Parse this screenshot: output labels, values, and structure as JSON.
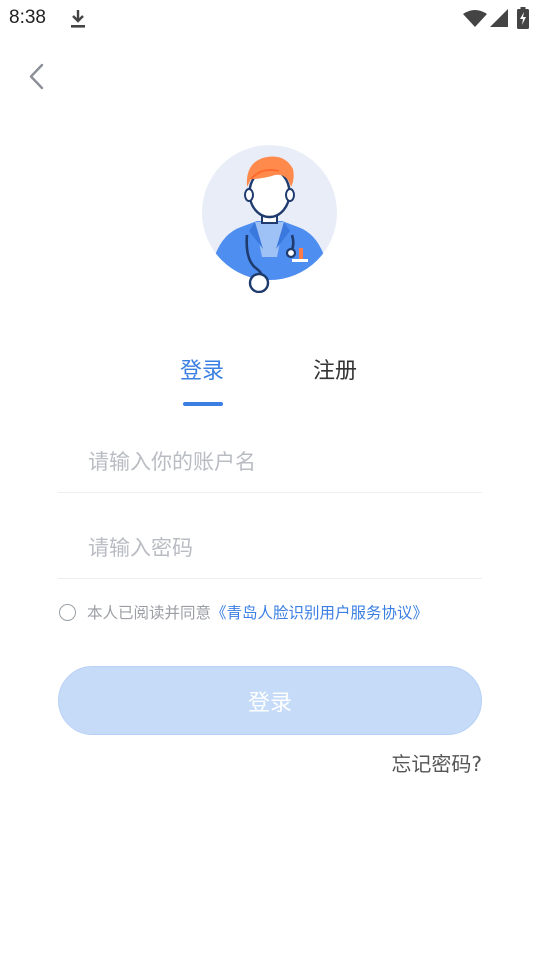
{
  "status_bar": {
    "time": "8:38",
    "icons": [
      "download-icon",
      "wifi-icon",
      "signal-icon",
      "battery-charging-icon"
    ]
  },
  "nav": {
    "back_icon": "chevron-left-icon"
  },
  "tabs": {
    "login_label": "登录",
    "register_label": "注册",
    "active": "login",
    "active_color": "#3b7fe3"
  },
  "form": {
    "account_placeholder": "请输入你的账户名",
    "account_value": "",
    "password_placeholder": "请输入密码",
    "password_value": ""
  },
  "agreement": {
    "checked": false,
    "text": "本人已阅读并同意",
    "link_text": "《青岛人脸识别用户服务协议》"
  },
  "login_button": {
    "label": "登录",
    "color": "#c5dbf8"
  },
  "forgot_password": "忘记密码?"
}
